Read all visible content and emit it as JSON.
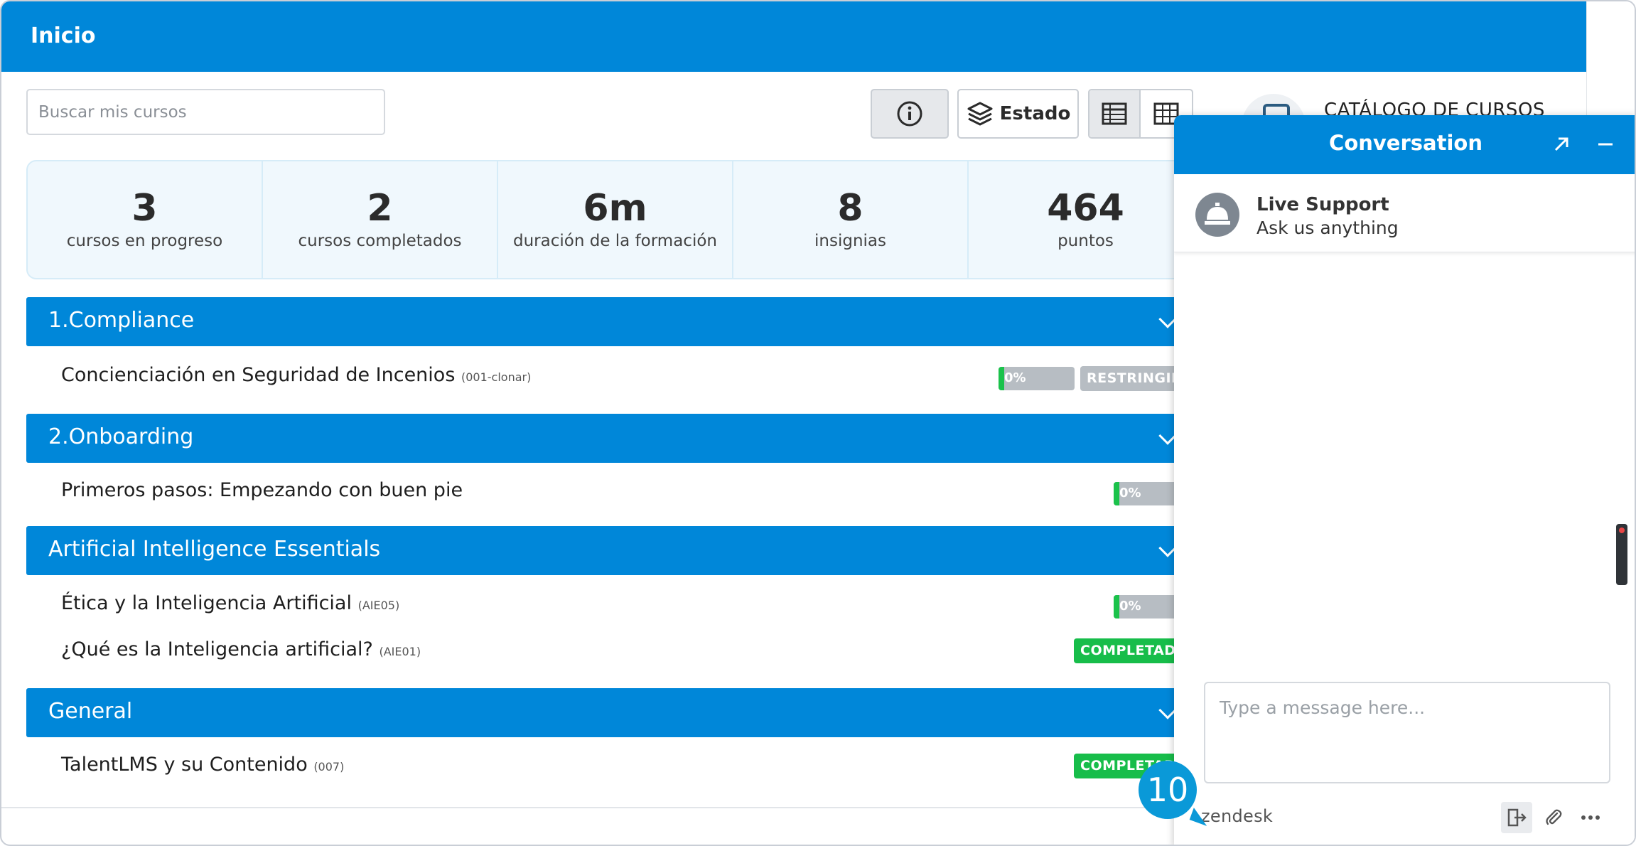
{
  "header": {
    "title": "Inicio"
  },
  "search": {
    "placeholder": "Buscar mis cursos"
  },
  "toolbar": {
    "estado_label": "Estado"
  },
  "catalog": {
    "label": "CATÁLOGO DE CURSOS"
  },
  "stats": [
    {
      "value": "3",
      "label": "cursos en progreso"
    },
    {
      "value": "2",
      "label": "cursos completados"
    },
    {
      "value": "6m",
      "label": "duración de la formación"
    },
    {
      "value": "8",
      "label": "insignias"
    },
    {
      "value": "464",
      "label": "puntos"
    }
  ],
  "sections": [
    {
      "title": "1.Compliance",
      "courses": [
        {
          "name": "Concienciación en Seguridad de Incenios",
          "code": "(001-clonar)",
          "progress_label": "0%",
          "progress": 0,
          "status": "RESTRINGIDO"
        }
      ]
    },
    {
      "title": "2.Onboarding",
      "courses": [
        {
          "name": "Primeros pasos: Empezando con buen pie",
          "code": "",
          "progress_label": "0%",
          "progress": 0
        }
      ]
    },
    {
      "title": "Artificial Intelligence Essentials",
      "courses": [
        {
          "name": "Ética y la Inteligencia Artificial",
          "code": "(AIE05)",
          "progress_label": "0%",
          "progress": 0
        },
        {
          "name": "¿Qué es la Inteligencia artificial?",
          "code": "(AIE01)",
          "status": "COMPLETADO"
        }
      ]
    },
    {
      "title": "General",
      "courses": [
        {
          "name": "TalentLMS y su Contenido",
          "code": "(007)",
          "status": "COMPLETADO"
        }
      ]
    }
  ],
  "chat": {
    "title": "Conversation",
    "agent_name": "Live Support",
    "agent_subtitle": "Ask us anything",
    "input_placeholder": "Type a message here...",
    "brand": "zendesk"
  },
  "step_marker": "10",
  "colors": {
    "primary": "#0087d9",
    "success": "#17bd4a",
    "muted": "#b7bdc3"
  }
}
